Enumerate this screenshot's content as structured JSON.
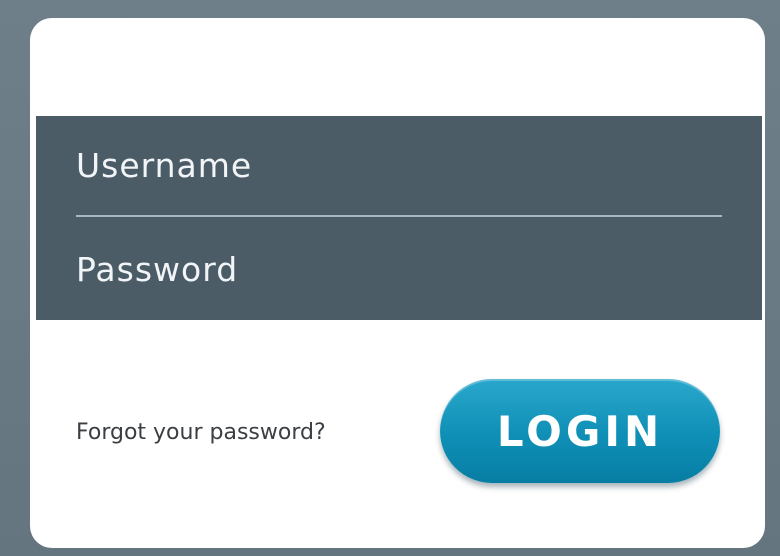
{
  "login_form": {
    "username_placeholder": "Username",
    "password_placeholder": "Password",
    "forgot_password_text": "Forgot your password?",
    "login_button_label": "LOGIN"
  },
  "colors": {
    "background": "#6e7e88",
    "card": "#ffffff",
    "field_panel": "#4b5c67",
    "field_text": "#f2f5f7",
    "divider": "#a9b7bf",
    "link_text": "#3a3f44",
    "button": "#0f8fb6",
    "button_text": "#ffffff"
  }
}
